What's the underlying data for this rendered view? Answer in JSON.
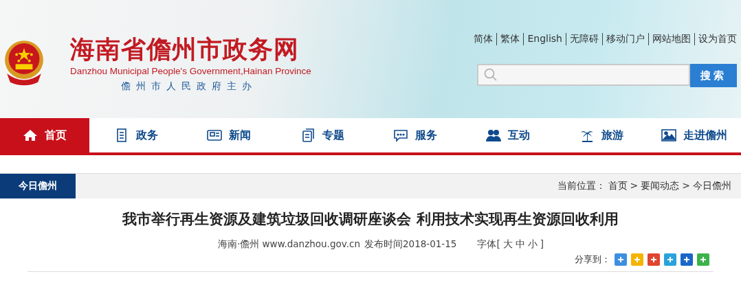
{
  "header": {
    "title": "海南省儋州市政务网",
    "subtitle": "Danzhou Municipal People's Government,Hainan Province",
    "sponsor": "儋州市人民政府主办"
  },
  "top_links": [
    "简体",
    "繁体",
    "English",
    "无障碍",
    "移动门户",
    "网站地图",
    "设为首页"
  ],
  "search": {
    "button": "搜索"
  },
  "nav": [
    {
      "label": "首页",
      "selected": true
    },
    {
      "label": "政务",
      "selected": false
    },
    {
      "label": "新闻",
      "selected": false
    },
    {
      "label": "专题",
      "selected": false
    },
    {
      "label": "服务",
      "selected": false
    },
    {
      "label": "互动",
      "selected": false
    },
    {
      "label": "旅游",
      "selected": false
    },
    {
      "label": "走进儋州",
      "selected": false
    }
  ],
  "section": {
    "label": "今日儋州",
    "location_label": "当前位置：",
    "breadcrumb": [
      "首页",
      "要闻动态",
      "今日儋州"
    ],
    "breadcrumb_separator": ">"
  },
  "article": {
    "title": "我市举行再生资源及建筑垃圾回收调研座谈会 利用技术实现再生资源回收利用",
    "source": "海南·儋州 www.danzhou.gov.cn",
    "published": "发布时间2018-01-15",
    "font_label": "字体[",
    "font_sizes": [
      "大",
      "中",
      "小"
    ],
    "font_end": "]",
    "share_label": "分享到："
  }
}
